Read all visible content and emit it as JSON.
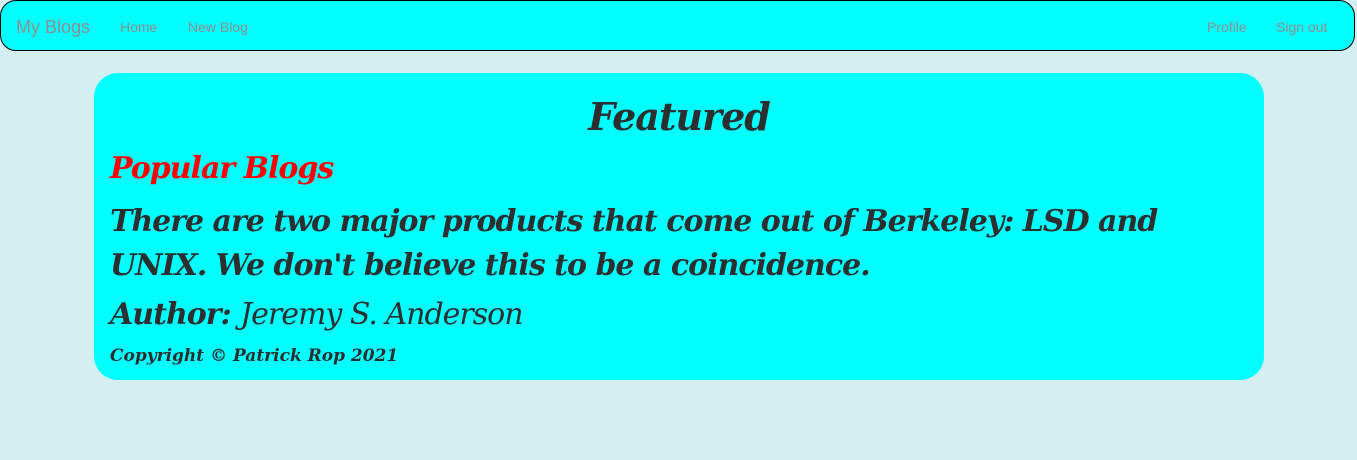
{
  "navbar": {
    "brand": "My Blogs",
    "links_left": [
      "Home",
      "New Blog"
    ],
    "links_right": [
      "Profile",
      "Sign out"
    ]
  },
  "featured": {
    "heading": "Featured",
    "subheading": "Popular Blogs",
    "quote": "There are two major products that come out of Berkeley: LSD and UNIX. We don't believe this to be a coincidence.",
    "author_label": "Author:",
    "author_name": "Jeremy S. Anderson",
    "copyright": "Copyright © Patrick Rop 2021"
  },
  "colors": {
    "page_background": "#d4eff1",
    "panel_background": "#00ffff",
    "subheading": "#ff0000",
    "text": "#2b2f30",
    "nav_text": "#8a8f8f"
  }
}
